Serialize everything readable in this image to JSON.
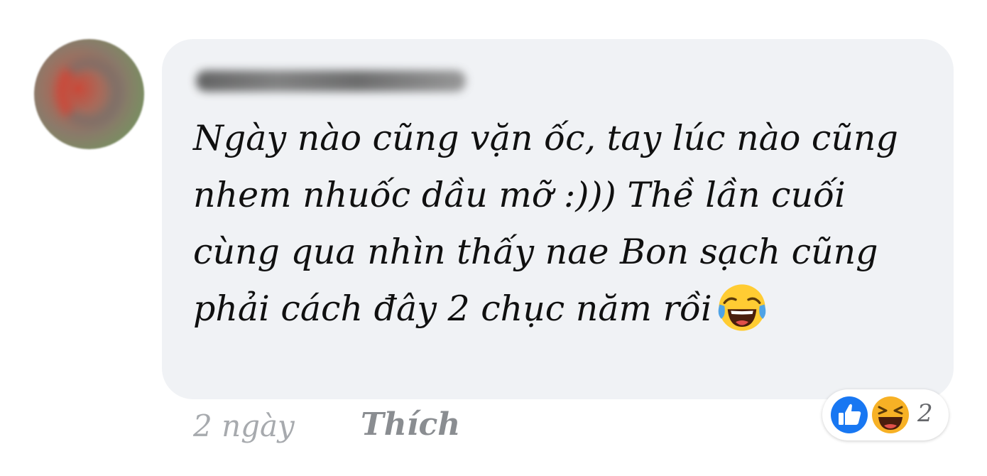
{
  "comment": {
    "author_name": "",
    "text": "Ngày nào cũng vặn ốc, tay lúc nào cũng nhem nhuốc dầu mỡ :))) Thề lần cuối cùng qua nhìn thấy nae Bon sạch cũng phải cách đây 2 chục năm rồi",
    "emoji": "tears-of-joy-icon"
  },
  "meta": {
    "timestamp": "2 ngày",
    "like_label": "Thích"
  },
  "reactions": {
    "icons": [
      "like-icon",
      "haha-icon"
    ],
    "count": "2"
  },
  "colors": {
    "bubble": "#f0f2f5",
    "like_blue": "#1877f2",
    "haha_yellow": "#f7b125",
    "meta_text": "#8a8d91"
  }
}
